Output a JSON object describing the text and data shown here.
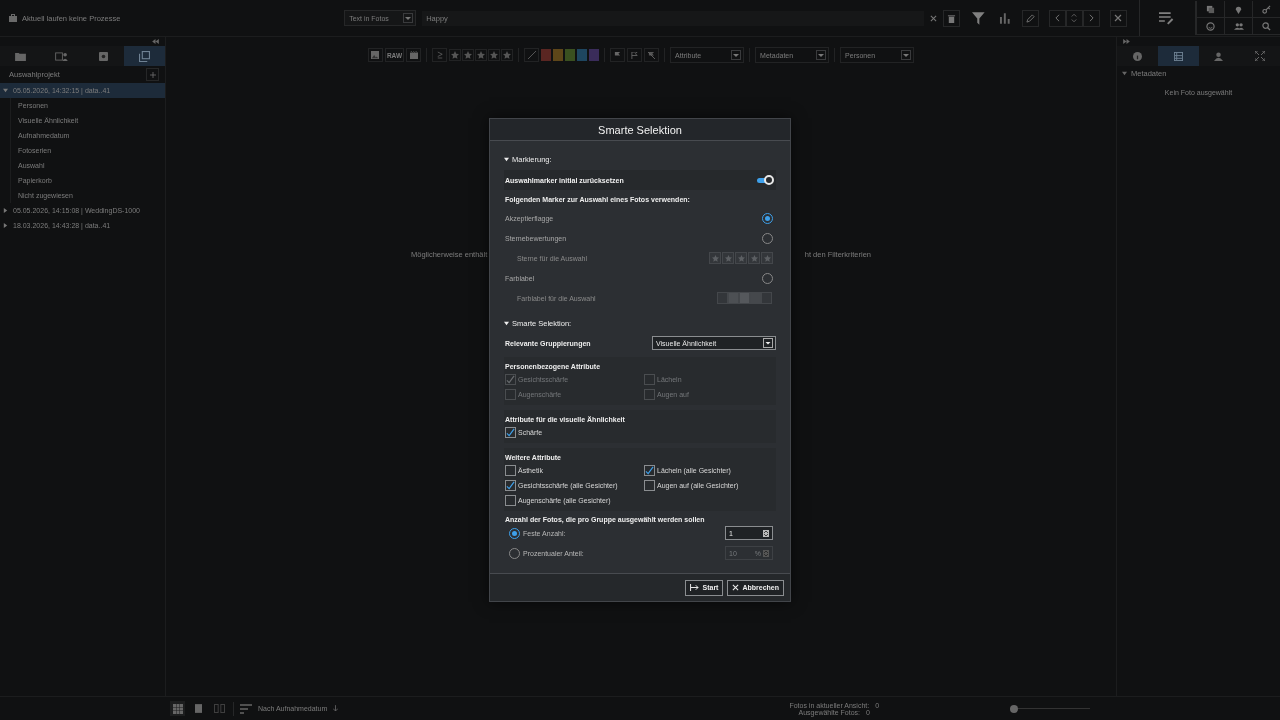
{
  "top_bar": {
    "status": "Aktuell laufen keine Prozesse",
    "search_scope": "Text in Fotos",
    "search_query": "Happy"
  },
  "sidebar": {
    "tabs": [
      {
        "selected": false
      },
      {
        "selected": false
      },
      {
        "selected": false
      },
      {
        "selected": true
      }
    ],
    "title": "Auswahlprojekt",
    "tree": [
      {
        "label": "05.05.2026, 14:32:15 | data..41",
        "expanded": true,
        "selected": true,
        "children": [
          {
            "label": "Personen"
          },
          {
            "label": "Visuelle Ähnlichkeit"
          },
          {
            "label": "Aufnahmedatum"
          },
          {
            "label": "Fotoserien"
          },
          {
            "label": "Auswahl"
          },
          {
            "label": "Papierkorb"
          },
          {
            "label": "Nicht zugewiesen"
          }
        ]
      },
      {
        "label": "05.05.2026, 14:15:08 | WeddingDS-1000",
        "expanded": false,
        "selected": false
      },
      {
        "label": "18.03.2026, 14:43:28 | data..41",
        "expanded": false,
        "selected": false
      }
    ]
  },
  "filter_bar": {
    "raw_label": "RAW",
    "stars": 0,
    "colors": [
      {
        "color": "#5a2622"
      },
      {
        "color": "#5e4619"
      },
      {
        "color": "#3a5020"
      },
      {
        "color": "#1e4660"
      },
      {
        "color": "#3a2c5a"
      }
    ],
    "dropdowns": [
      "Attribute",
      "Metadaten",
      "Personen"
    ]
  },
  "message_parts": [
    "Möglicherweise enthält",
    "ht den Filterkriterien"
  ],
  "right_panel": {
    "tabs": [
      {
        "selected": false
      },
      {
        "selected": true
      },
      {
        "selected": false
      },
      {
        "selected": false
      }
    ],
    "section": "Metadaten",
    "empty_text": "Kein Foto ausgewählt"
  },
  "status_bar": {
    "sort": "Nach Aufnahmedatum",
    "counts": [
      {
        "label": "Fotos in aktueller Ansicht:",
        "value": "0"
      },
      {
        "label": "Ausgewählte Fotos:",
        "value": "0"
      }
    ],
    "zoom": {
      "level": 0
    }
  },
  "dialog": {
    "title": "Smarte Selektion",
    "marking": {
      "heading": "Markierung:",
      "expanded": true,
      "reset": {
        "label": "Auswahlmarker initial zurücksetzen",
        "on": true
      },
      "prompt": "Folgenden Marker zur Auswahl eines Fotos verwenden:",
      "options": [
        {
          "kind": "radio",
          "label": "Akzeptierflagge",
          "selected": true
        },
        {
          "kind": "radio",
          "label": "Sternebewertungen",
          "selected": false
        },
        {
          "kind": "stars",
          "label": "Sterne für die Auswahl",
          "stars": 0
        },
        {
          "kind": "radio",
          "label": "Farblabel",
          "selected": false
        },
        {
          "kind": "swatches",
          "label": "Farblabel für die Auswahl"
        }
      ]
    },
    "smart": {
      "heading": "Smarte Selektion:",
      "expanded": true,
      "grouping": {
        "label": "Relevante Gruppierungen",
        "value": "Visuelle Ähnlichkeit"
      },
      "groups": [
        {
          "title": "Personenbezogene Attribute",
          "disabled": true,
          "items": [
            {
              "label": "Gesichtsschärfe",
              "checked": true
            },
            {
              "label": "Lächeln",
              "checked": false
            },
            {
              "label": "Augenschärfe",
              "checked": false
            },
            {
              "label": "Augen auf",
              "checked": false
            }
          ]
        },
        {
          "title": "Attribute für die visuelle Ähnlichkeit",
          "disabled": false,
          "items": [
            {
              "label": "Schärfe",
              "checked": true
            }
          ]
        },
        {
          "title": "Weitere Attribute",
          "disabled": false,
          "items": [
            {
              "label": "Ästhetik",
              "checked": false
            },
            {
              "label": "Lächeln (alle Gesichter)",
              "checked": true
            },
            {
              "label": "Gesichtsschärfe (alle Gesichter)",
              "checked": true
            },
            {
              "label": "Augen auf (alle Gesichter)",
              "checked": false
            },
            {
              "label": "Augenschärfe (alle Gesichter)",
              "checked": false
            }
          ]
        }
      ],
      "count": {
        "title": "Anzahl der Fotos, die pro Gruppe ausgewählt werden sollen",
        "options": [
          {
            "label": "Feste Anzahl:",
            "selected": true,
            "value": "1"
          },
          {
            "label": "Prozentualer Anteil:",
            "selected": false,
            "value": "10",
            "unit": "%"
          }
        ]
      }
    },
    "buttons": [
      {
        "kind": "start",
        "label": "Start"
      },
      {
        "kind": "cancel",
        "label": "Abbrechen"
      }
    ]
  }
}
